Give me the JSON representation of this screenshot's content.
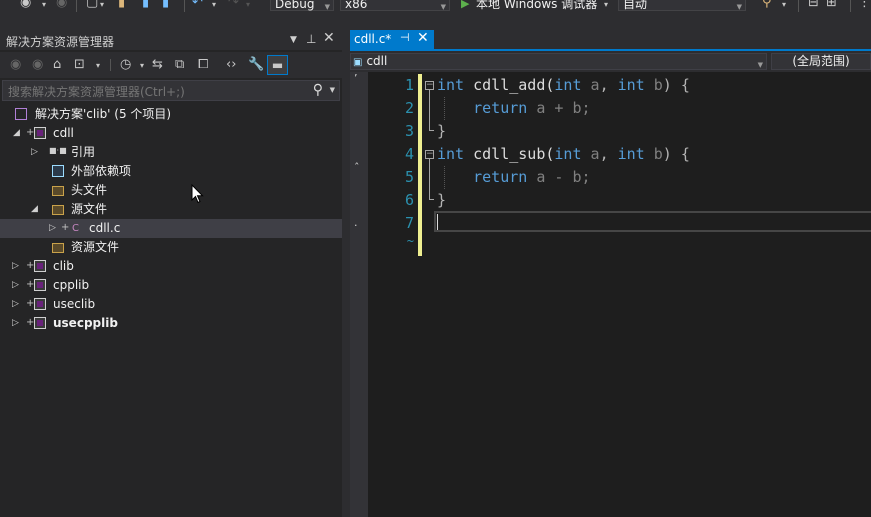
{
  "toolbar": {
    "config": "Debug",
    "platform": "x86",
    "debugger_label": "本地 Windows 调试器",
    "auto_label": "自动"
  },
  "solution_explorer": {
    "title": "解决方案资源管理器",
    "search_placeholder": "搜索解决方案资源管理器(Ctrl+;)",
    "solution_label": "解决方案'clib' (5 个项目)",
    "tree": [
      {
        "label": "cdll",
        "bold": false
      },
      {
        "label": "引用"
      },
      {
        "label": "外部依赖项"
      },
      {
        "label": "头文件"
      },
      {
        "label": "源文件"
      },
      {
        "label": "cdll.c"
      },
      {
        "label": "资源文件"
      },
      {
        "label": "clib"
      },
      {
        "label": "cpplib"
      },
      {
        "label": "useclib"
      },
      {
        "label": "usecpplib",
        "bold": true
      }
    ]
  },
  "editor": {
    "tab_name": "cdll.c*",
    "nav_scope": "cdll",
    "nav_member": "(全局范围)",
    "line_numbers": [
      "1",
      "2",
      "3",
      "4",
      "5",
      "6",
      "7"
    ],
    "code": {
      "l1": {
        "kw": "int",
        "fn": " cdll_add(",
        "a1": "int",
        "p1": " a",
        "s1": ", ",
        "a2": "int",
        "p2": " b",
        "end": ") {"
      },
      "l2": {
        "kw": "return",
        "rest": " a + b;"
      },
      "l3": "}",
      "l4": {
        "kw": "int",
        "fn": " cdll_sub(",
        "a1": "int",
        "p1": " a",
        "s1": ", ",
        "a2": "int",
        "p2": " b",
        "end": ") {"
      },
      "l5": {
        "kw": "return",
        "rest": " a - b;"
      },
      "l6": "}"
    }
  },
  "colors": {
    "accent": "#007acc",
    "keyword": "#569cd6",
    "line_number": "#2b91af",
    "change_bar": "#efef91"
  }
}
